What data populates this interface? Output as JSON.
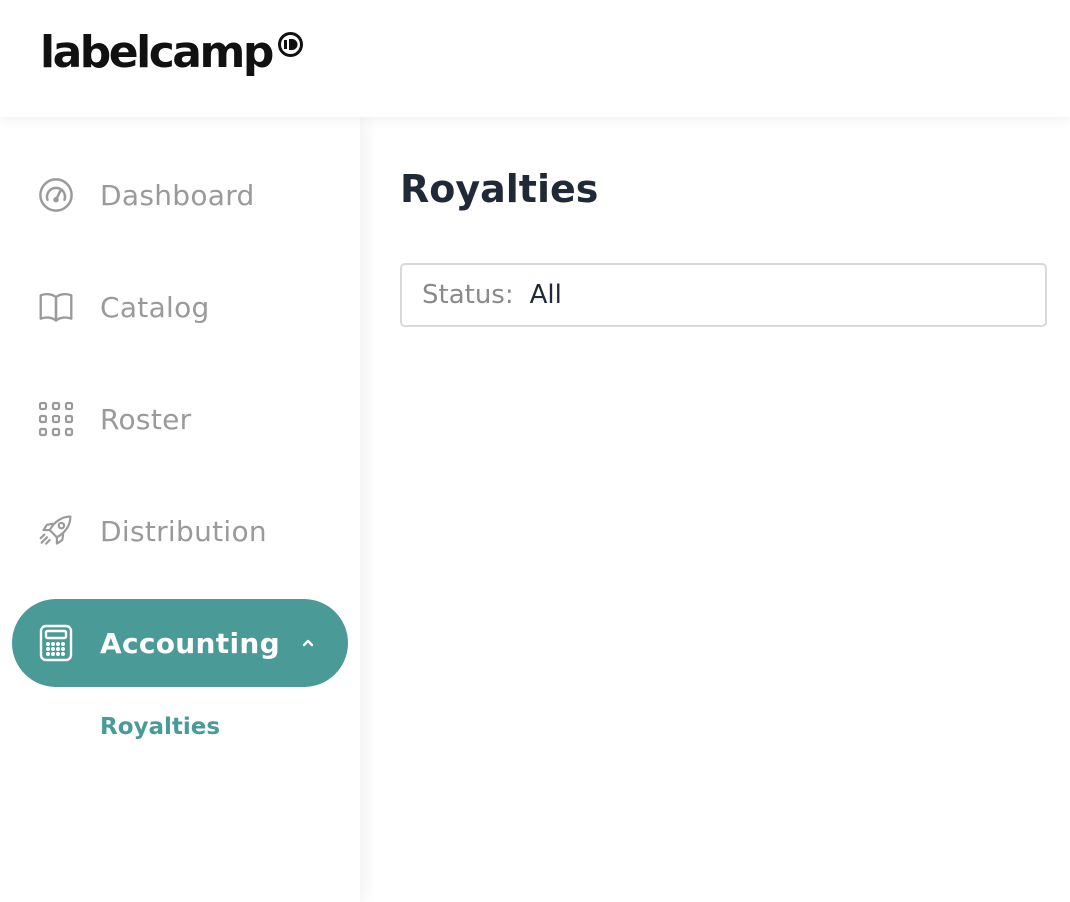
{
  "brand": {
    "name": "labelcamp",
    "text_color": "#111111"
  },
  "sidebar": {
    "items": [
      {
        "label": "Dashboard",
        "icon": "dashboard-gauge-icon"
      },
      {
        "label": "Catalog",
        "icon": "book-icon"
      },
      {
        "label": "Roster",
        "icon": "grid-dots-icon"
      },
      {
        "label": "Distribution",
        "icon": "rocket-icon"
      },
      {
        "label": "Accounting",
        "icon": "calculator-icon",
        "active": true,
        "expanded": true
      }
    ],
    "sub_items": [
      {
        "label": "Royalties",
        "active": true
      }
    ],
    "accent_color": "#4a9a98",
    "inactive_color": "#9a9a9a"
  },
  "main": {
    "title": "Royalties",
    "filter": {
      "label": "Status:",
      "value": "All"
    }
  }
}
